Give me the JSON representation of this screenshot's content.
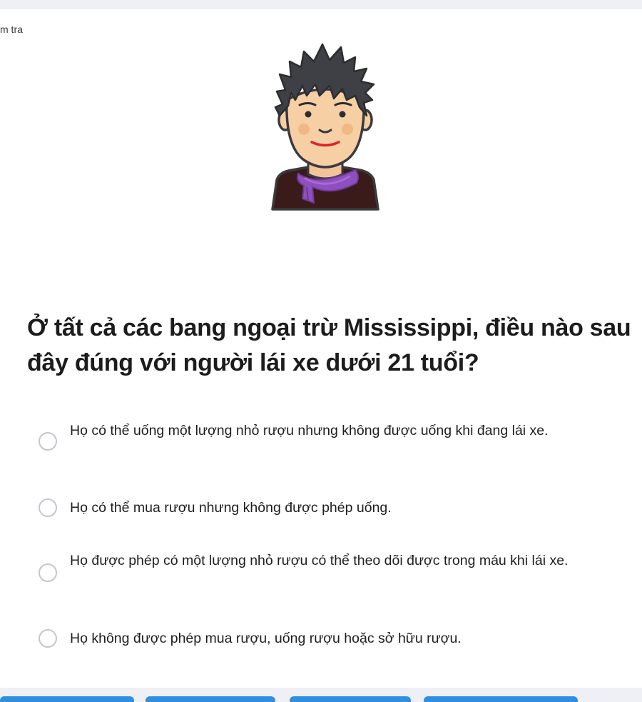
{
  "breadcrumb": {
    "label": "m tra"
  },
  "question": {
    "text": "Ở tất cả các bang ngoại trừ Mississippi, điều nào sau đây đúng với người lái xe dưới 21 tuổi?"
  },
  "options": [
    {
      "text": "Họ có thể uống một lượng nhỏ rượu nhưng không được uống khi đang lái xe."
    },
    {
      "text": "Họ có thể mua rượu nhưng không được phép uống."
    },
    {
      "text": "Họ được phép có một lượng nhỏ rượu có thể theo dõi được trong máu khi lái xe."
    },
    {
      "text": "Họ không được phép mua rượu, uống rượu hoặc sở hữu rượu."
    }
  ],
  "illustration": {
    "icon": "person-avatar-icon"
  },
  "colors": {
    "page_background": "#eef0f5",
    "card_background": "#ffffff",
    "text_primary": "#1c1c1c",
    "radio_border": "#c4c6cf",
    "scarf": "#8e4fbf",
    "skin": "#f7cfa4",
    "hair": "#3f4045",
    "shirt": "#3a1b19",
    "bottom_buttons": "#2f8fe0"
  }
}
